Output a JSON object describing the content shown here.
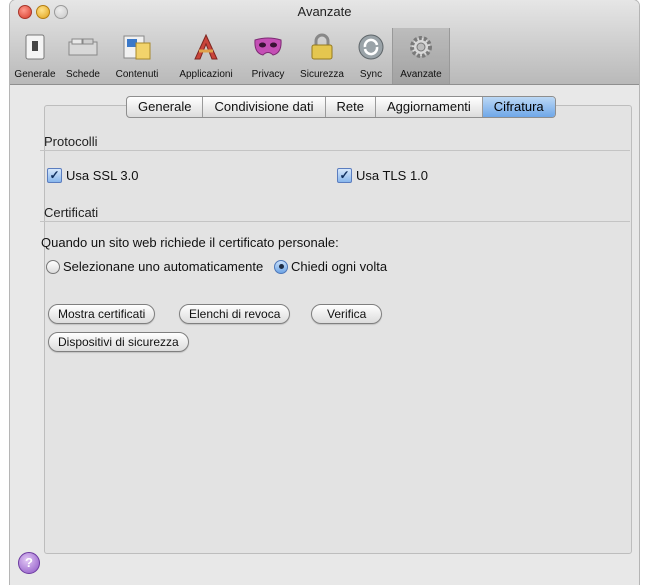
{
  "window": {
    "title": "Avanzate"
  },
  "toolbar": {
    "items": [
      {
        "label": "Generale",
        "icon": "switch-icon"
      },
      {
        "label": "Schede",
        "icon": "tabs-icon"
      },
      {
        "label": "Contenuti",
        "icon": "content-icon"
      },
      {
        "label": "Applicazioni",
        "icon": "applications-icon"
      },
      {
        "label": "Privacy",
        "icon": "privacy-mask-icon"
      },
      {
        "label": "Sicurezza",
        "icon": "padlock-icon"
      },
      {
        "label": "Sync",
        "icon": "sync-icon"
      },
      {
        "label": "Avanzate",
        "icon": "gear-icon"
      }
    ]
  },
  "tabs": [
    "Generale",
    "Condivisione dati",
    "Rete",
    "Aggiornamenti",
    "Cifratura"
  ],
  "selected_tab": "Cifratura",
  "protocolli": {
    "heading": "Protocolli",
    "ssl": {
      "label": "Usa SSL 3.0",
      "checked": true
    },
    "tls": {
      "label": "Usa TLS 1.0",
      "checked": true
    }
  },
  "certificati": {
    "heading": "Certificati",
    "prompt": "Quando un sito web richiede il certificato personale:",
    "auto": {
      "label": "Selezionane uno automaticamente",
      "selected": false
    },
    "ask": {
      "label": "Chiedi ogni volta",
      "selected": true
    }
  },
  "buttons": {
    "mostra": "Mostra certificati",
    "elenchi": "Elenchi di revoca",
    "verifica": "Verifica",
    "dispositivi": "Dispositivi di sicurezza"
  },
  "help": {
    "label": "?"
  },
  "colors": {
    "selected_tab": "#6fa7e8",
    "help_button": "#8b52c4",
    "window_background": "#e8e8e8"
  }
}
